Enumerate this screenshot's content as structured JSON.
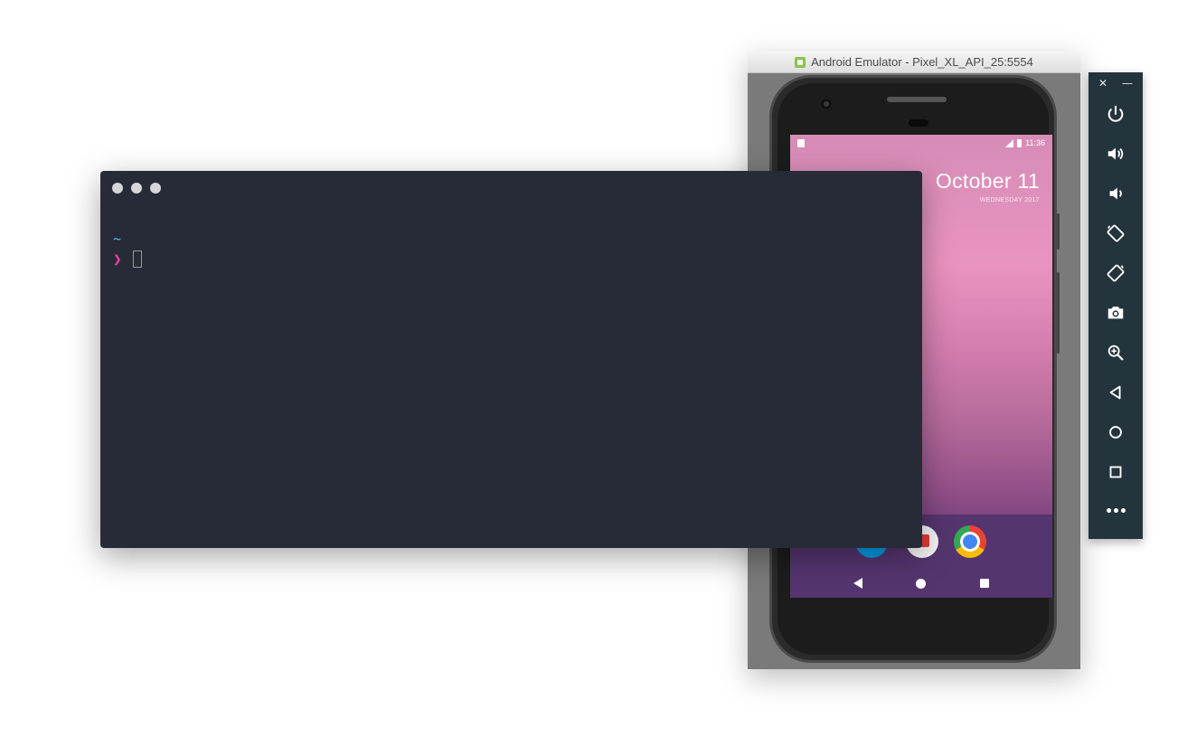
{
  "emulator": {
    "title": "Android Emulator - Pixel_XL_API_25:5554",
    "status_time": "11:36",
    "date_big": "October 11",
    "date_small": "WEDNESDAY 2017"
  },
  "toolbar": {
    "close": "✕",
    "minimize": "—",
    "more": "•••",
    "buttons": [
      "power-icon",
      "volume-up-icon",
      "volume-down-icon",
      "rotate-left-icon",
      "rotate-right-icon",
      "screenshot-icon",
      "zoom-icon",
      "back-icon",
      "home-icon",
      "overview-icon",
      "more-icon"
    ]
  },
  "terminal": {
    "cwd": "~",
    "prompt": "❯"
  },
  "colors": {
    "terminal_bg": "#272b38",
    "cwd": "#4fc1e9",
    "prompt": "#ff3ea5",
    "toolbar_bg": "#24343d"
  }
}
